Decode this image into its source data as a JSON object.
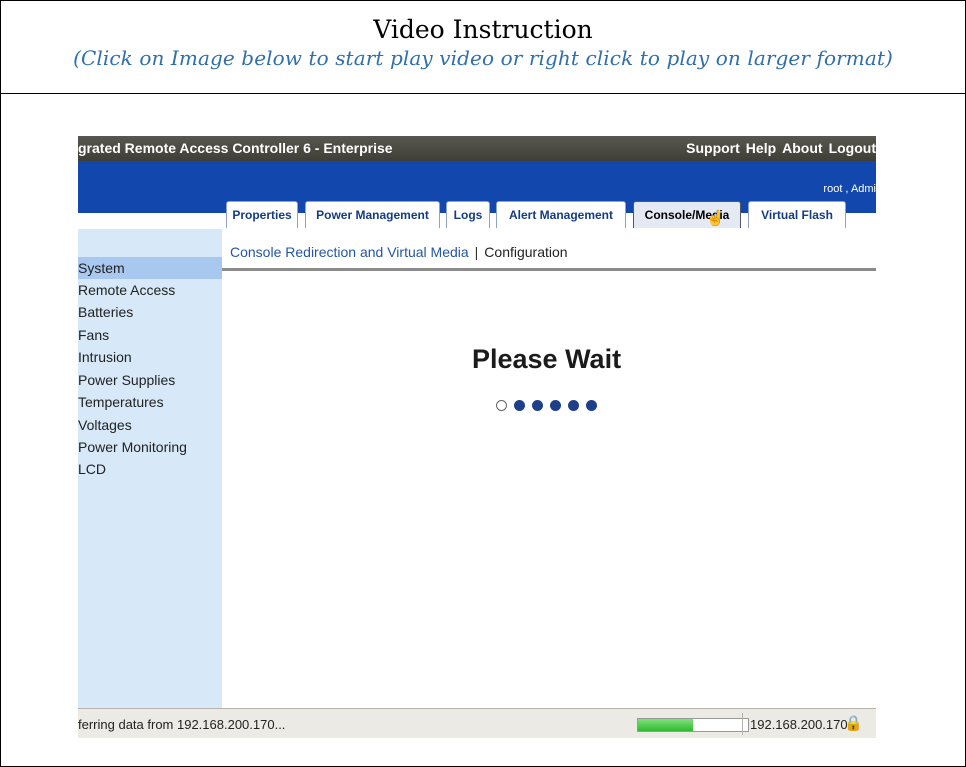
{
  "doc": {
    "title": "Video Instruction",
    "subtitle": "(Click on Image below to start play video or right click to play on larger format)"
  },
  "app": {
    "title": "grated Remote Access Controller 6 - Enterprise",
    "top_links": [
      "Support",
      "Help",
      "About",
      "Logout"
    ],
    "user": "root , Admi"
  },
  "tabs": [
    {
      "label": "Properties"
    },
    {
      "label": "Power Management"
    },
    {
      "label": "Logs"
    },
    {
      "label": "Alert Management"
    },
    {
      "label": "Console/Media",
      "active": true
    },
    {
      "label": "Virtual Flash"
    }
  ],
  "sidebar": {
    "items": [
      "System",
      "Remote Access",
      "Batteries",
      "Fans",
      "Intrusion",
      "Power Supplies",
      "Temperatures",
      "Voltages",
      "Power Monitoring",
      "LCD"
    ],
    "selected": "System"
  },
  "subnav": {
    "link": "Console Redirection and Virtual Media",
    "separator": "|",
    "current": "Configuration"
  },
  "main": {
    "wait_text": "Please Wait",
    "loading_dots": {
      "total": 6,
      "empty_index": 0
    }
  },
  "statusbar": {
    "message": "ferring data from 192.168.200.170...",
    "progress": 0.5,
    "ip": "192.168.200.170"
  },
  "colors": {
    "header_blue": "#1247ad",
    "sidebar_bg": "#d7e8f8",
    "subtitle_blue": "#2f6fad",
    "progress_green": "#2fbb31"
  },
  "icons": {
    "cursor": "hand-pointer-icon",
    "lock": "lock-icon"
  }
}
